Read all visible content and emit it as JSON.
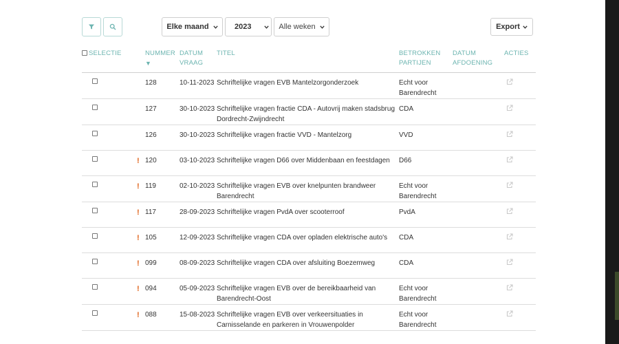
{
  "toolbar": {
    "month_select": "Elke maand",
    "year_select": "2023",
    "week_select": "Alle weken",
    "export_label": "Export"
  },
  "table": {
    "headers": {
      "selectie": "SELECTIE",
      "nummer": "NUMMER",
      "datum_vraag_1": "DATUM",
      "datum_vraag_2": "VRAAG",
      "titel": "TITEL",
      "betrokken_1": "BETROKKEN",
      "betrokken_2": "PARTIJEN",
      "afdoening_1": "DATUM",
      "afdoening_2": "AFDOENING",
      "acties": "ACTIES",
      "sort_indicator": "▼"
    },
    "rows": [
      {
        "urgent": "",
        "number": "128",
        "date": "10-11-2023",
        "title": "Schriftelijke vragen EVB Mantelzorgonderzoek",
        "parties": "Echt voor Barendrecht",
        "done": ""
      },
      {
        "urgent": "",
        "number": "127",
        "date": "30-10-2023",
        "title": "Schriftelijke vragen fractie CDA - Autovrij maken stadsbrug Dordrecht-Zwijndrecht",
        "parties": "CDA",
        "done": ""
      },
      {
        "urgent": "",
        "number": "126",
        "date": "30-10-2023",
        "title": "Schriftelijke vragen fractie VVD - Mantelzorg",
        "parties": "VVD",
        "done": ""
      },
      {
        "urgent": "!",
        "number": "120",
        "date": "03-10-2023",
        "title": "Schriftelijke vragen D66 over Middenbaan en feestdagen",
        "parties": "D66",
        "done": ""
      },
      {
        "urgent": "!",
        "number": "119",
        "date": "02-10-2023",
        "title": "Schriftelijke vragen EVB over knelpunten brandweer Barendrecht",
        "parties": "Echt voor Barendrecht",
        "done": ""
      },
      {
        "urgent": "!",
        "number": "117",
        "date": "28-09-2023",
        "title": "Schriftelijke vragen PvdA over scooterroof",
        "parties": "PvdA",
        "done": ""
      },
      {
        "urgent": "!",
        "number": "105",
        "date": "12-09-2023",
        "title": "Schriftelijke vragen CDA over opladen elektrische auto's",
        "parties": "CDA",
        "done": ""
      },
      {
        "urgent": "!",
        "number": "099",
        "date": "08-09-2023",
        "title": "Schriftelijke vragen CDA over afsluiting Boezemweg",
        "parties": "CDA",
        "done": ""
      },
      {
        "urgent": "!",
        "number": "094",
        "date": "05-09-2023",
        "title": "Schriftelijke vragen EVB over de bereikbaarheid van Barendrecht-Oost",
        "parties": "Echt voor Barendrecht",
        "done": ""
      },
      {
        "urgent": "!",
        "number": "088",
        "date": "15-08-2023",
        "title": "Schriftelijke vragen EVB over verkeersituaties in Carnisselande en parkeren in Vrouwenpolder",
        "parties": "Echt voor Barendrecht",
        "done": ""
      }
    ]
  },
  "icons": {
    "filter": "filter-icon",
    "search": "search-icon",
    "external_link": "external-link-icon",
    "chevron": "chevron-down-icon"
  },
  "colors": {
    "accent": "#6cb4b0",
    "urgent": "#e0641b",
    "border": "#cfcfcf"
  }
}
